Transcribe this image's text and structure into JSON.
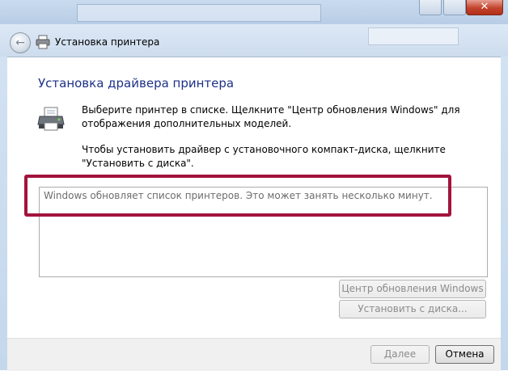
{
  "window": {
    "title": "Установка принтера",
    "close_label": "✕"
  },
  "wizard": {
    "heading": "Установка драйвера принтера",
    "description_1": "Выберите принтер в списке. Щелкните \"Центр обновления Windows\" для отображения дополнительных моделей.",
    "description_2": "Чтобы установить драйвер с установочного компакт-диска, щелкните \"Установить с диска\".",
    "list_status": "Windows обновляет список принтеров. Это может занять несколько минут.",
    "windows_update_button": "Центр обновления Windows",
    "have_disk_button": "Установить с диска...",
    "next_button": "Далее",
    "cancel_button": "Отмена"
  },
  "annotation": {
    "highlight_color": "#a3143d"
  },
  "icons": {
    "back": "back-arrow-icon",
    "printer": "printer-icon"
  }
}
